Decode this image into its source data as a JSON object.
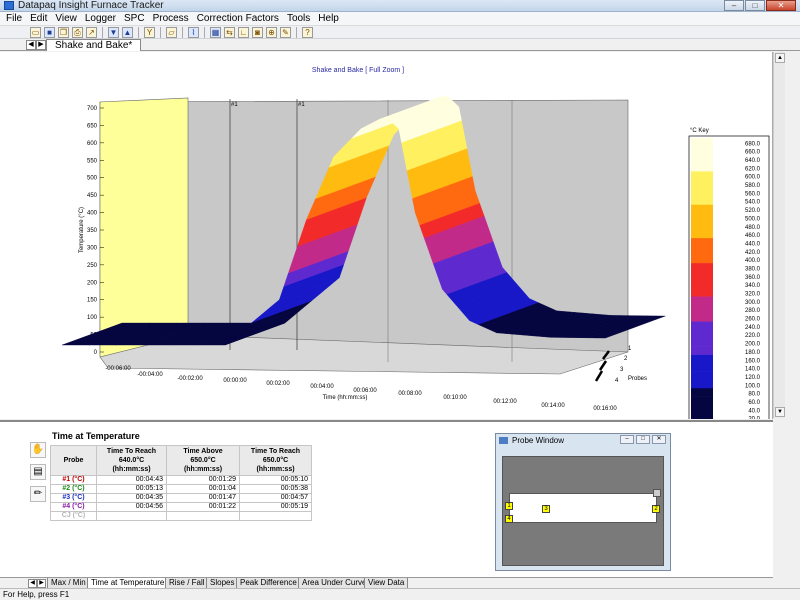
{
  "window": {
    "title": "Datapaq Insight Furnace Tracker",
    "min": "–",
    "max": "□",
    "close": "✕"
  },
  "menu": [
    "File",
    "Edit",
    "View",
    "Logger",
    "SPC",
    "Process",
    "Correction Factors",
    "Tools",
    "Help"
  ],
  "toolbar_icons": [
    "open-icon",
    "save-icon",
    "copy-icon",
    "print-icon",
    "export-icon",
    "download-icon",
    "upload-icon",
    "filter-icon",
    "folder-icon",
    "chart-icon",
    "grid-icon",
    "align-icon",
    "axis-icon",
    "camera-icon",
    "zoom-icon",
    "tool-icon",
    "help-icon"
  ],
  "doc_tab": {
    "label": "Shake and Bake*"
  },
  "chart": {
    "title": "Shake and Bake [ Full Zoom ]",
    "ylabel": "Temperature (°C)",
    "xlabel": "Time (hh:mm:ss)",
    "zlabel": "Probes",
    "marker1": "#1",
    "marker2": "#1",
    "key_title": "°C Key"
  },
  "chart_data": {
    "type": "surface",
    "title": "Shake and Bake [ Full Zoom ]",
    "ylabel": "Temperature (°C)",
    "xlabel": "Time (hh:mm:ss)",
    "zlabel": "Probes",
    "yticks": [
      "0",
      "50",
      "100",
      "150",
      "200",
      "250",
      "300",
      "350",
      "400",
      "450",
      "500",
      "550",
      "600",
      "650",
      "700"
    ],
    "xticks": [
      "-00:06:00",
      "-00:04:00",
      "-00:02:00",
      "00:00:00",
      "00:02:00",
      "00:04:00",
      "00:06:00",
      "00:08:00",
      "00:10:00",
      "00:12:00",
      "00:14:00",
      "00:16:00"
    ],
    "zticks": [
      "1",
      "2",
      "3",
      "4"
    ],
    "ylim": [
      0,
      700
    ],
    "key": {
      "title": "°C Key",
      "values": [
        "680.0",
        "660.0",
        "640.0",
        "620.0",
        "600.0",
        "580.0",
        "560.0",
        "540.0",
        "520.0",
        "500.0",
        "480.0",
        "460.0",
        "440.0",
        "420.0",
        "400.0",
        "380.0",
        "360.0",
        "340.0",
        "320.0",
        "300.0",
        "280.0",
        "260.0",
        "240.0",
        "220.0",
        "200.0",
        "180.0",
        "160.0",
        "140.0",
        "120.0",
        "100.0",
        "80.0",
        "60.0",
        "40.0",
        "20.0",
        "0.0"
      ]
    },
    "series": [
      {
        "times_min": [
          -6,
          0,
          2,
          3,
          4,
          5,
          5.7,
          6,
          6.4,
          7,
          8,
          9,
          10,
          12,
          14
        ],
        "temps": [
          20,
          20,
          150,
          380,
          560,
          640,
          668,
          670,
          640,
          400,
          180,
          90,
          55,
          42,
          40
        ]
      }
    ]
  },
  "panel": {
    "title": "Time at Temperature",
    "headers": [
      "Probe",
      "Time To Reach\n640.0°C (hh:mm:ss)",
      "Time Above\n650.0°C (hh:mm:ss)",
      "Time To Reach\n650.0°C (hh:mm:ss)"
    ],
    "rows": [
      {
        "probe": "#1 (°C)",
        "color": "#c00000",
        "a": "00:04:43",
        "b": "00:01:29",
        "c": "00:05:10"
      },
      {
        "probe": "#2 (°C)",
        "color": "#1b8a1b",
        "a": "00:05:13",
        "b": "00:01:04",
        "c": "00:05:38"
      },
      {
        "probe": "#3 (°C)",
        "color": "#1c2fc9",
        "a": "00:04:35",
        "b": "00:01:47",
        "c": "00:04:57"
      },
      {
        "probe": "#4 (°C)",
        "color": "#8a1aa8",
        "a": "00:04:56",
        "b": "00:01:22",
        "c": "00:05:19"
      },
      {
        "probe": "CJ (°C)",
        "color": "#b5b5b5",
        "a": "",
        "b": "",
        "c": ""
      }
    ]
  },
  "probe_window": {
    "title": "Probe Window",
    "labels": [
      "1",
      "4",
      "3",
      "2"
    ]
  },
  "bottom_tabs": [
    "Max / Min",
    "Time at Temperature",
    "Rise / Fall",
    "Slopes",
    "Peak Difference",
    "Area Under Curve",
    "View Data"
  ],
  "active_bottom_tab": "Time at Temperature",
  "status": "For Help, press F1"
}
